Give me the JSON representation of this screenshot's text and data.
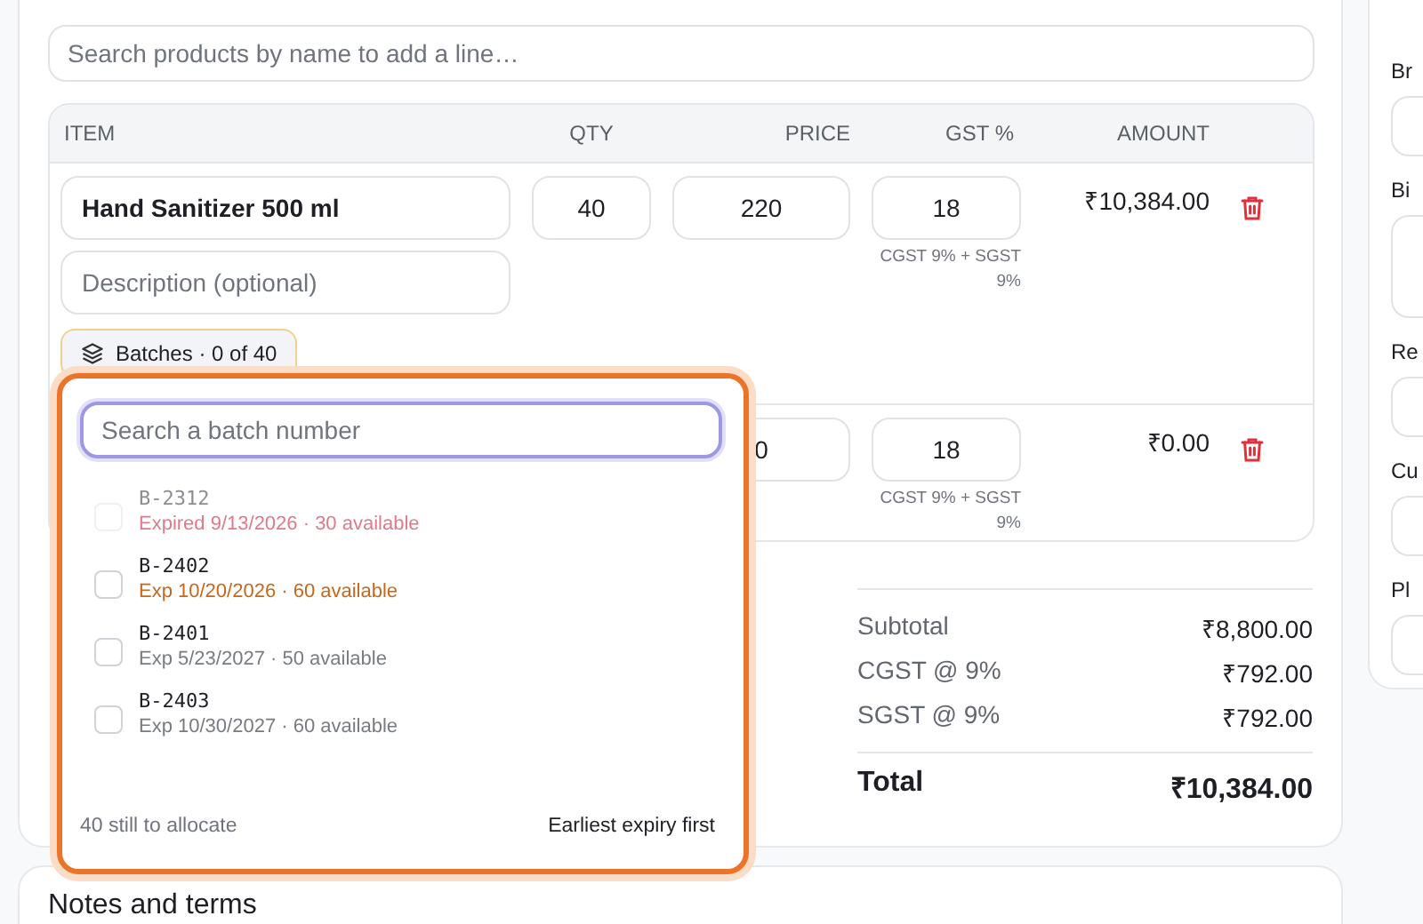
{
  "product_search": {
    "placeholder": "Search products by name to add a line…"
  },
  "table": {
    "columns": [
      "ITEM",
      "QTY",
      "PRICE",
      "GST %",
      "AMOUNT"
    ],
    "rows": [
      {
        "item": "Hand Sanitizer 500 ml",
        "description_placeholder": "Description (optional)",
        "qty": "40",
        "price": "220",
        "gst": "18",
        "gst_note": "CGST 9% + SGST 9%",
        "amount": "₹10,384.00",
        "batches_button": "Batches · 0 of 40"
      },
      {
        "item": "",
        "qty": "",
        "price": "0",
        "gst": "18",
        "gst_note": "CGST 9% + SGST 9%",
        "amount": "₹0.00"
      }
    ]
  },
  "totals": [
    {
      "label": "Subtotal",
      "value": "₹8,800.00",
      "kind": "line"
    },
    {
      "label": "CGST @ 9%",
      "value": "₹792.00",
      "kind": "line"
    },
    {
      "label": "SGST @ 9%",
      "value": "₹792.00",
      "kind": "line"
    },
    {
      "label": "Total",
      "value": "₹10,384.00",
      "kind": "total"
    }
  ],
  "notes_card": {
    "title": "Notes and terms"
  },
  "batch_popup": {
    "search": {
      "placeholder": "Search a batch number"
    },
    "batches": [
      {
        "code": "B-2312",
        "detail": "Expired 9/13/2026 · 30 available",
        "color": "#e07a8a",
        "checked": false,
        "disabled": true
      },
      {
        "code": "B-2402",
        "detail": "Exp 10/20/2026 · 60 available",
        "color": "#c8661a",
        "checked": false,
        "disabled": false
      },
      {
        "code": "B-2401",
        "detail": "Exp 5/23/2027 · 50 available",
        "color": "#777b82",
        "checked": false,
        "disabled": false
      },
      {
        "code": "B-2403",
        "detail": "Exp 10/30/2027 · 60 available",
        "color": "#777b82",
        "checked": false,
        "disabled": false
      }
    ],
    "remaining": "40 still to allocate",
    "sort": "Earliest expiry first"
  },
  "side_panel": {
    "fields": [
      {
        "label": "Br",
        "kind": "input"
      },
      {
        "label": "Bi",
        "kind": "textarea"
      },
      {
        "label": "Re",
        "kind": "input"
      },
      {
        "label": "Cu",
        "kind": "input"
      },
      {
        "label": "Pl",
        "kind": "input"
      }
    ]
  }
}
